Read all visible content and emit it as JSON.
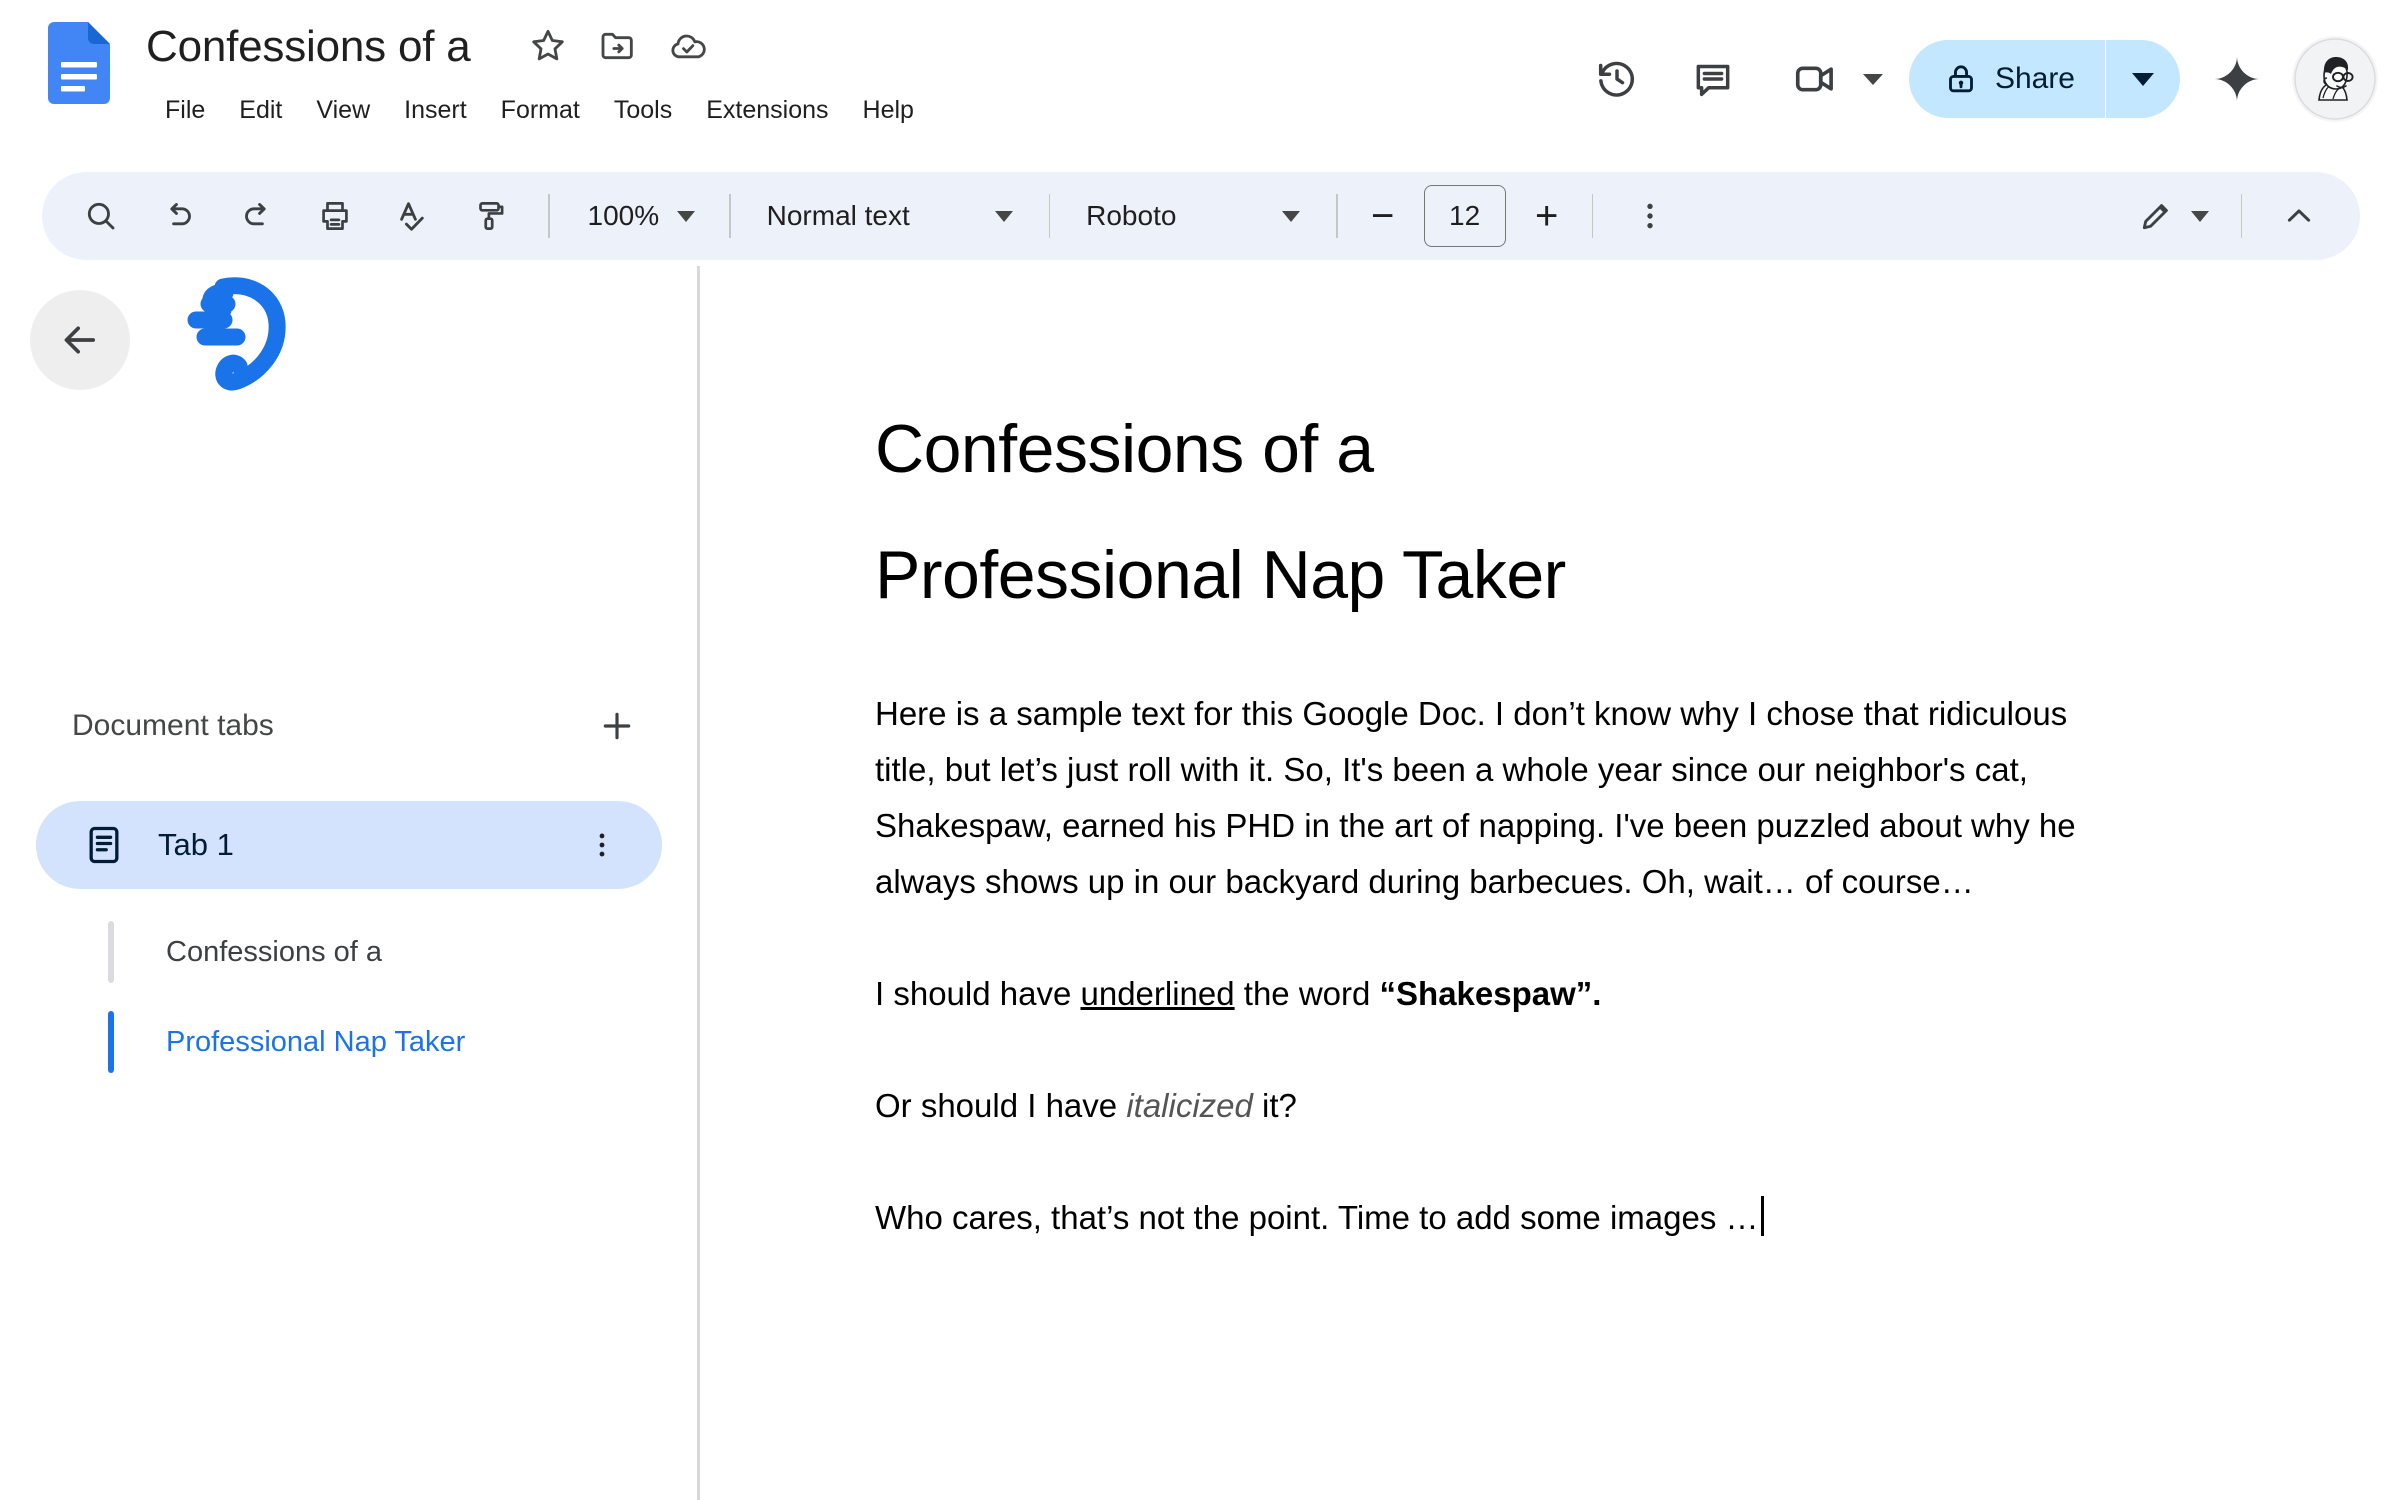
{
  "app": {
    "name": "Google Docs",
    "logo_icon": "docs-file-icon",
    "accent_blue": "#1a73e8",
    "share_bg": "#c2e7ff",
    "toolbar_bg": "#edf2fa",
    "tab_active_bg": "#d3e3fd"
  },
  "header": {
    "doc_title": "Confessions of a",
    "title_icons": [
      {
        "name": "star-icon",
        "label": "Star"
      },
      {
        "name": "move-to-folder-icon",
        "label": "Move"
      },
      {
        "name": "cloud-saved-icon",
        "label": "Saved to Drive"
      }
    ],
    "menus": [
      {
        "label": "File"
      },
      {
        "label": "Edit"
      },
      {
        "label": "View"
      },
      {
        "label": "Insert"
      },
      {
        "label": "Format"
      },
      {
        "label": "Tools"
      },
      {
        "label": "Extensions"
      },
      {
        "label": "Help"
      }
    ],
    "right_actions": [
      {
        "name": "version-history-icon",
        "label": "Last edit"
      },
      {
        "name": "comment-icon",
        "label": "Comments"
      },
      {
        "name": "meet-camera-icon",
        "label": "Join a call"
      }
    ],
    "share": {
      "label": "Share",
      "lock_icon": "lock-icon",
      "caret_icon": "chevron-down-icon"
    },
    "gemini": {
      "name": "gemini-sparkle-icon",
      "label": "Ask Gemini"
    },
    "avatar": {
      "name": "user-avatar",
      "label": "Account"
    }
  },
  "toolbar": {
    "items": [
      {
        "name": "search-icon",
        "label": "Search"
      },
      {
        "name": "undo-icon",
        "label": "Undo"
      },
      {
        "name": "redo-icon",
        "label": "Redo"
      },
      {
        "name": "print-icon",
        "label": "Print"
      },
      {
        "name": "spellcheck-icon",
        "label": "Spelling and grammar check"
      },
      {
        "name": "paint-format-icon",
        "label": "Paint format"
      }
    ],
    "zoom": {
      "value": "100%",
      "caret": "chevron-down-icon"
    },
    "style": {
      "value": "Normal text",
      "caret": "chevron-down-icon"
    },
    "font": {
      "value": "Roboto",
      "caret": "chevron-down-icon"
    },
    "font_size": {
      "value": "12",
      "decrease": "−",
      "increase": "+"
    },
    "more_options": {
      "name": "more-vert-icon",
      "label": "More"
    },
    "edit_mode": {
      "name": "pencil-icon",
      "label": "Editing",
      "caret": "chevron-down-icon"
    },
    "collapse": {
      "name": "chevron-up-icon",
      "label": "Hide the menus"
    }
  },
  "sidebar": {
    "back": {
      "name": "back-arrow-icon",
      "label": "Back"
    },
    "brand_icon": "blue-swirl-logo",
    "section_title": "Document tabs",
    "add_tab": {
      "name": "plus-icon",
      "label": "Add tab"
    },
    "tabs": [
      {
        "label": "Tab 1",
        "icon": "document-tab-icon",
        "kebab": "more-vert-icon",
        "active": true,
        "headings": [
          {
            "text": "Confessions of a",
            "active": false,
            "color": "#3c4043",
            "bar_color": "#dadce0"
          },
          {
            "text": "Professional Nap Taker",
            "active": true,
            "color": "#1a73e8",
            "bar_color": "#1a73e8"
          }
        ]
      }
    ]
  },
  "document": {
    "title_lines": [
      "Confessions of a",
      "Professional Nap Taker"
    ],
    "paragraphs": [
      {
        "id": "p1",
        "runs": [
          {
            "text": "Here is a sample text for this Google Doc. I don’t know why I chose that ridiculous title, but let’s just roll with it. So, It's been a whole year since our neighbor's cat, Shakespaw, earned his PHD in the art of napping. I've been puzzled about why he always shows up in our backyard during barbecues. Oh, wait… of course…",
            "style": "normal"
          }
        ]
      },
      {
        "id": "p2",
        "runs": [
          {
            "text": "I should have ",
            "style": "normal"
          },
          {
            "text": "underlined",
            "style": "underline"
          },
          {
            "text": " the word ",
            "style": "normal"
          },
          {
            "text": "“Shakespaw”.",
            "style": "bold"
          }
        ]
      },
      {
        "id": "p3",
        "runs": [
          {
            "text": "Or should I have ",
            "style": "normal"
          },
          {
            "text": "italicized",
            "style": "italic"
          },
          {
            "text": " it?",
            "style": "normal"
          }
        ]
      },
      {
        "id": "p4",
        "runs": [
          {
            "text": "Who cares, that’s not the point. Time to add some images …",
            "style": "normal"
          }
        ],
        "has_cursor": true
      }
    ]
  }
}
